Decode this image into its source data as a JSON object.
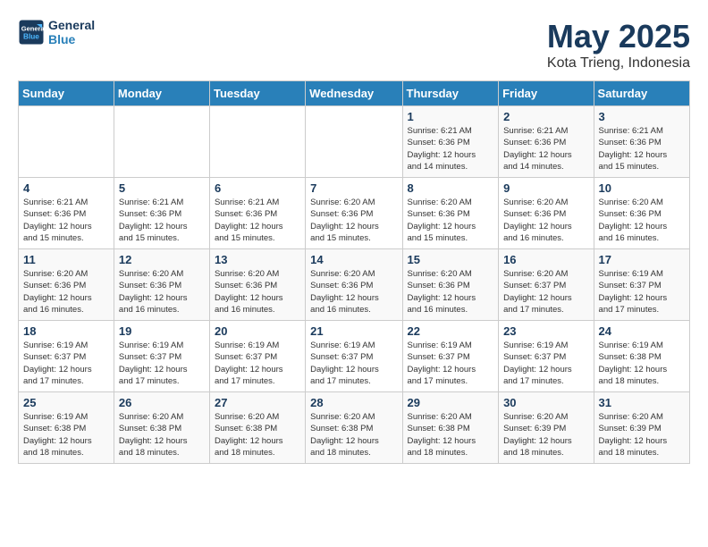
{
  "header": {
    "logo_line1": "General",
    "logo_line2": "Blue",
    "month": "May 2025",
    "location": "Kota Trieng, Indonesia"
  },
  "weekdays": [
    "Sunday",
    "Monday",
    "Tuesday",
    "Wednesday",
    "Thursday",
    "Friday",
    "Saturday"
  ],
  "weeks": [
    [
      {
        "day": "",
        "info": ""
      },
      {
        "day": "",
        "info": ""
      },
      {
        "day": "",
        "info": ""
      },
      {
        "day": "",
        "info": ""
      },
      {
        "day": "1",
        "info": "Sunrise: 6:21 AM\nSunset: 6:36 PM\nDaylight: 12 hours\nand 14 minutes."
      },
      {
        "day": "2",
        "info": "Sunrise: 6:21 AM\nSunset: 6:36 PM\nDaylight: 12 hours\nand 14 minutes."
      },
      {
        "day": "3",
        "info": "Sunrise: 6:21 AM\nSunset: 6:36 PM\nDaylight: 12 hours\nand 15 minutes."
      }
    ],
    [
      {
        "day": "4",
        "info": "Sunrise: 6:21 AM\nSunset: 6:36 PM\nDaylight: 12 hours\nand 15 minutes."
      },
      {
        "day": "5",
        "info": "Sunrise: 6:21 AM\nSunset: 6:36 PM\nDaylight: 12 hours\nand 15 minutes."
      },
      {
        "day": "6",
        "info": "Sunrise: 6:21 AM\nSunset: 6:36 PM\nDaylight: 12 hours\nand 15 minutes."
      },
      {
        "day": "7",
        "info": "Sunrise: 6:20 AM\nSunset: 6:36 PM\nDaylight: 12 hours\nand 15 minutes."
      },
      {
        "day": "8",
        "info": "Sunrise: 6:20 AM\nSunset: 6:36 PM\nDaylight: 12 hours\nand 15 minutes."
      },
      {
        "day": "9",
        "info": "Sunrise: 6:20 AM\nSunset: 6:36 PM\nDaylight: 12 hours\nand 16 minutes."
      },
      {
        "day": "10",
        "info": "Sunrise: 6:20 AM\nSunset: 6:36 PM\nDaylight: 12 hours\nand 16 minutes."
      }
    ],
    [
      {
        "day": "11",
        "info": "Sunrise: 6:20 AM\nSunset: 6:36 PM\nDaylight: 12 hours\nand 16 minutes."
      },
      {
        "day": "12",
        "info": "Sunrise: 6:20 AM\nSunset: 6:36 PM\nDaylight: 12 hours\nand 16 minutes."
      },
      {
        "day": "13",
        "info": "Sunrise: 6:20 AM\nSunset: 6:36 PM\nDaylight: 12 hours\nand 16 minutes."
      },
      {
        "day": "14",
        "info": "Sunrise: 6:20 AM\nSunset: 6:36 PM\nDaylight: 12 hours\nand 16 minutes."
      },
      {
        "day": "15",
        "info": "Sunrise: 6:20 AM\nSunset: 6:36 PM\nDaylight: 12 hours\nand 16 minutes."
      },
      {
        "day": "16",
        "info": "Sunrise: 6:20 AM\nSunset: 6:37 PM\nDaylight: 12 hours\nand 17 minutes."
      },
      {
        "day": "17",
        "info": "Sunrise: 6:19 AM\nSunset: 6:37 PM\nDaylight: 12 hours\nand 17 minutes."
      }
    ],
    [
      {
        "day": "18",
        "info": "Sunrise: 6:19 AM\nSunset: 6:37 PM\nDaylight: 12 hours\nand 17 minutes."
      },
      {
        "day": "19",
        "info": "Sunrise: 6:19 AM\nSunset: 6:37 PM\nDaylight: 12 hours\nand 17 minutes."
      },
      {
        "day": "20",
        "info": "Sunrise: 6:19 AM\nSunset: 6:37 PM\nDaylight: 12 hours\nand 17 minutes."
      },
      {
        "day": "21",
        "info": "Sunrise: 6:19 AM\nSunset: 6:37 PM\nDaylight: 12 hours\nand 17 minutes."
      },
      {
        "day": "22",
        "info": "Sunrise: 6:19 AM\nSunset: 6:37 PM\nDaylight: 12 hours\nand 17 minutes."
      },
      {
        "day": "23",
        "info": "Sunrise: 6:19 AM\nSunset: 6:37 PM\nDaylight: 12 hours\nand 17 minutes."
      },
      {
        "day": "24",
        "info": "Sunrise: 6:19 AM\nSunset: 6:38 PM\nDaylight: 12 hours\nand 18 minutes."
      }
    ],
    [
      {
        "day": "25",
        "info": "Sunrise: 6:19 AM\nSunset: 6:38 PM\nDaylight: 12 hours\nand 18 minutes."
      },
      {
        "day": "26",
        "info": "Sunrise: 6:20 AM\nSunset: 6:38 PM\nDaylight: 12 hours\nand 18 minutes."
      },
      {
        "day": "27",
        "info": "Sunrise: 6:20 AM\nSunset: 6:38 PM\nDaylight: 12 hours\nand 18 minutes."
      },
      {
        "day": "28",
        "info": "Sunrise: 6:20 AM\nSunset: 6:38 PM\nDaylight: 12 hours\nand 18 minutes."
      },
      {
        "day": "29",
        "info": "Sunrise: 6:20 AM\nSunset: 6:38 PM\nDaylight: 12 hours\nand 18 minutes."
      },
      {
        "day": "30",
        "info": "Sunrise: 6:20 AM\nSunset: 6:39 PM\nDaylight: 12 hours\nand 18 minutes."
      },
      {
        "day": "31",
        "info": "Sunrise: 6:20 AM\nSunset: 6:39 PM\nDaylight: 12 hours\nand 18 minutes."
      }
    ]
  ]
}
